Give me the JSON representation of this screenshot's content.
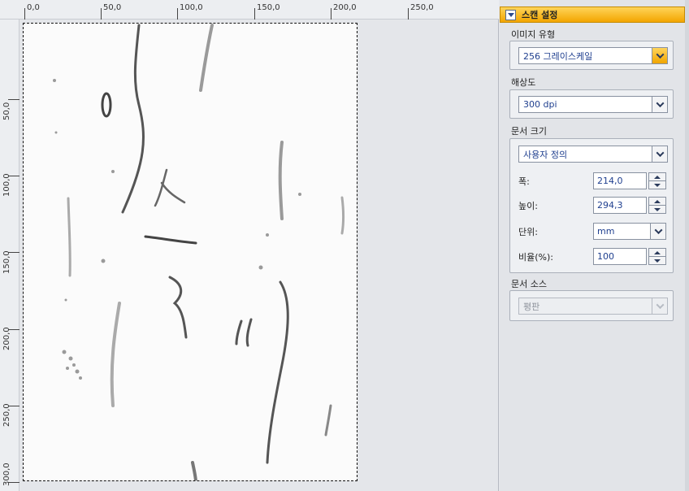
{
  "ruler": {
    "top_labels": [
      "0,0",
      "50,0",
      "100,0",
      "150,0",
      "200,0",
      "250,0"
    ],
    "left_labels": [
      "50,0",
      "100,0",
      "150,0",
      "200,0",
      "250,0",
      "300,0"
    ]
  },
  "panel": {
    "title": "스캔 설정",
    "image_type": {
      "label": "이미지 유형",
      "value": "256 그레이스케일"
    },
    "resolution": {
      "label": "해상도",
      "value": "300 dpi"
    },
    "document_size": {
      "label": "문서 크기",
      "value": "사용자 정의",
      "width_label": "폭:",
      "width_value": "214,0",
      "height_label": "높이:",
      "height_value": "294,3",
      "unit_label": "단위:",
      "unit_value": "mm",
      "ratio_label": "비율(%):",
      "ratio_value": "100"
    },
    "document_source": {
      "label": "문서 소스",
      "value": "평판"
    }
  },
  "colors": {
    "accent": "#f3a500",
    "value_text": "#1f3f8f"
  }
}
